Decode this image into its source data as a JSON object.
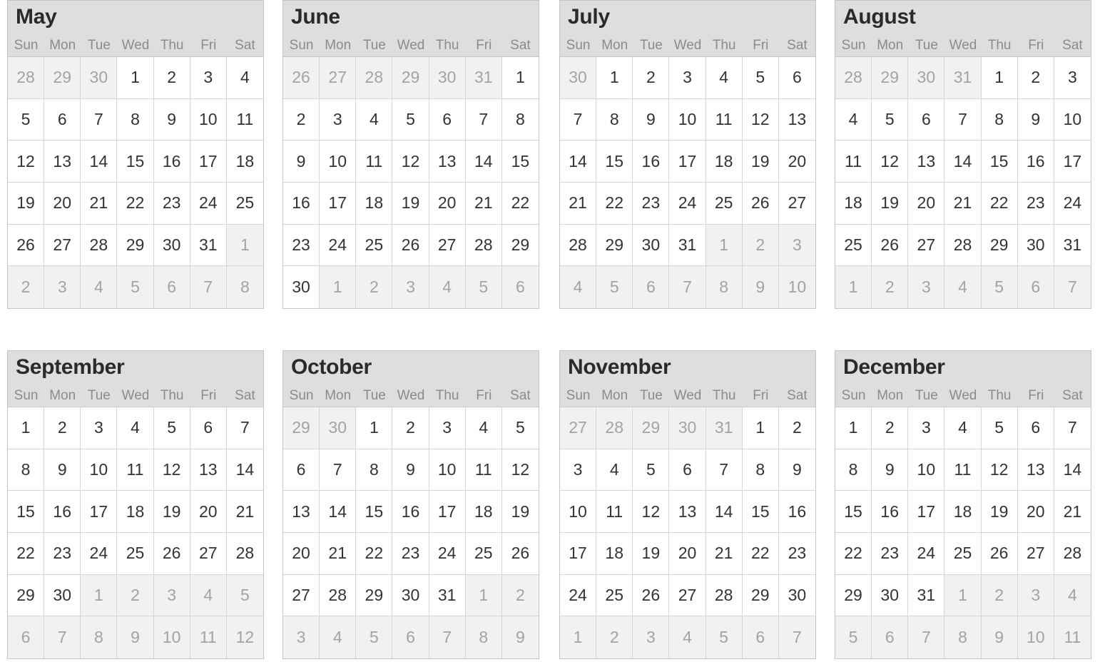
{
  "weekdays": [
    "Sun",
    "Mon",
    "Tue",
    "Wed",
    "Thu",
    "Fri",
    "Sat"
  ],
  "months": [
    {
      "name": "May",
      "lead": [
        28,
        29,
        30
      ],
      "days": 31
    },
    {
      "name": "June",
      "lead": [
        26,
        27,
        28,
        29,
        30,
        31
      ],
      "days": 30
    },
    {
      "name": "July",
      "lead": [
        30
      ],
      "days": 31
    },
    {
      "name": "August",
      "lead": [
        28,
        29,
        30,
        31
      ],
      "days": 31
    },
    {
      "name": "September",
      "lead": [],
      "days": 30
    },
    {
      "name": "October",
      "lead": [
        29,
        30
      ],
      "days": 31
    },
    {
      "name": "November",
      "lead": [
        27,
        28,
        29,
        30,
        31
      ],
      "days": 30
    },
    {
      "name": "December",
      "lead": [],
      "days": 31
    }
  ]
}
